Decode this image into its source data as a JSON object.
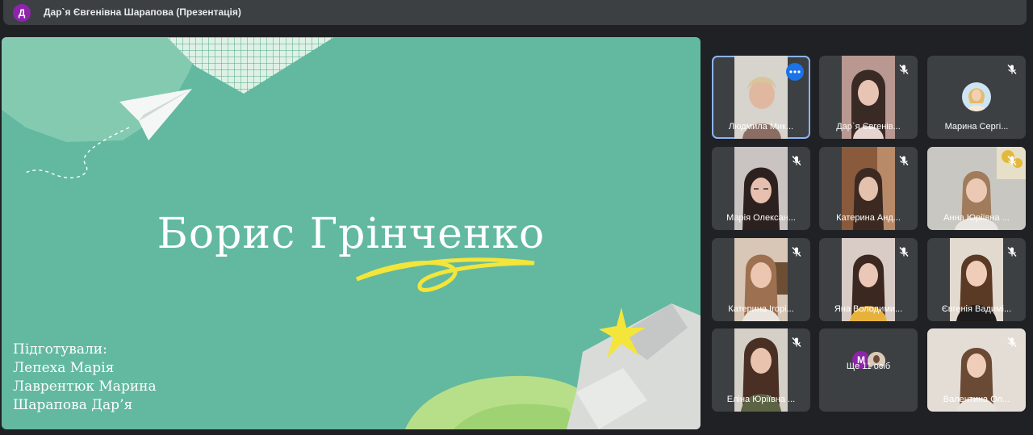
{
  "header": {
    "avatar_letter": "Д",
    "title": "Дар`я Євгенівна Шарапова (Презентація)"
  },
  "slide": {
    "title": "Борис Грінченко",
    "credits": [
      "Підготували:",
      "Лепеха Марія",
      "Лаврентюк Марина",
      "Шарапова Дар’я"
    ],
    "colors": {
      "background": "#62b99f",
      "accent": "#f3e53a"
    }
  },
  "participants": [
    {
      "name": "Людмила Мик...",
      "muted": false,
      "active": true
    },
    {
      "name": "Дар`я Євгенів...",
      "muted": true
    },
    {
      "name": "Марина Сергі...",
      "muted": true
    },
    {
      "name": "Марія Олексан...",
      "muted": true
    },
    {
      "name": "Катерина Анд...",
      "muted": true
    },
    {
      "name": "Анна Юріївна ...",
      "muted": true
    },
    {
      "name": "Катерина Ігорі...",
      "muted": true
    },
    {
      "name": "Яна Володими...",
      "muted": true
    },
    {
      "name": "Євгенія Вадимі...",
      "muted": true
    },
    {
      "name": "Еліна Юріївна ...",
      "muted": true
    },
    {
      "name": "Ще 11 осіб",
      "avatar_letter": "M"
    },
    {
      "name": "Валентина Ол...",
      "muted": true
    }
  ]
}
